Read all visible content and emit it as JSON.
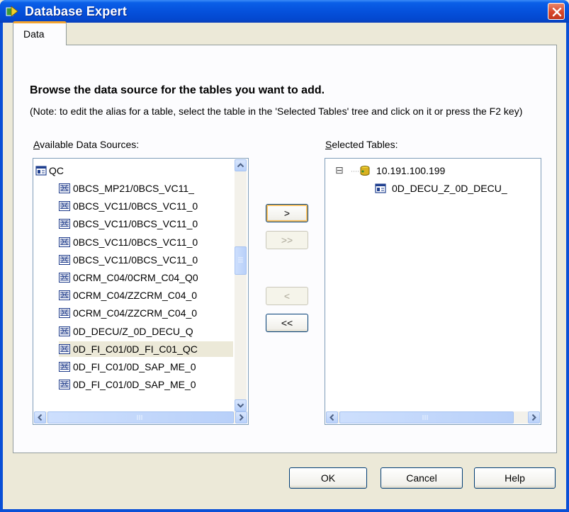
{
  "window": {
    "title": "Database Expert"
  },
  "tabs": [
    {
      "label": "Data"
    }
  ],
  "heading": "Browse the data source for the tables you want to add.",
  "note": "(Note: to edit the alias for a table, select the table in the 'Selected Tables' tree and click on it or press the F2 key)",
  "available": {
    "label_accel": "A",
    "label_rest": "vailable Data Sources:",
    "root": {
      "label": "QC",
      "icon": "database-icon"
    },
    "items": [
      {
        "label": "0BCS_MP21/0BCS_VC11_",
        "icon": "query-icon",
        "selected": false
      },
      {
        "label": "0BCS_VC11/0BCS_VC11_0",
        "icon": "query-icon",
        "selected": false
      },
      {
        "label": "0BCS_VC11/0BCS_VC11_0",
        "icon": "query-icon",
        "selected": false
      },
      {
        "label": "0BCS_VC11/0BCS_VC11_0",
        "icon": "query-icon",
        "selected": false
      },
      {
        "label": "0BCS_VC11/0BCS_VC11_0",
        "icon": "query-icon",
        "selected": false
      },
      {
        "label": "0CRM_C04/0CRM_C04_Q0",
        "icon": "query-icon",
        "selected": false
      },
      {
        "label": "0CRM_C04/ZZCRM_C04_0",
        "icon": "query-icon",
        "selected": false
      },
      {
        "label": "0CRM_C04/ZZCRM_C04_0",
        "icon": "query-icon",
        "selected": false
      },
      {
        "label": "0D_DECU/Z_0D_DECU_Q",
        "icon": "query-icon",
        "selected": false
      },
      {
        "label": "0D_FI_C01/0D_FI_C01_QC",
        "icon": "query-icon",
        "selected": true
      },
      {
        "label": "0D_FI_C01/0D_SAP_ME_0",
        "icon": "query-icon",
        "selected": false
      },
      {
        "label": "0D_FI_C01/0D_SAP_ME_0",
        "icon": "query-icon",
        "selected": false
      }
    ]
  },
  "selected_tables": {
    "label_accel": "S",
    "label_rest": "elected Tables:",
    "server": {
      "label": "10.191.100.199",
      "icon": "server-icon",
      "expander": "⊟"
    },
    "table": {
      "label": "0D_DECU_Z_0D_DECU_",
      "icon": "table-icon"
    }
  },
  "transfer_buttons": {
    "add": ">",
    "add_all": ">>",
    "remove": "<",
    "remove_all": "<<"
  },
  "footer": {
    "ok": "OK",
    "cancel": "Cancel",
    "help": "Help"
  },
  "colors": {
    "title_blue": "#0551dc",
    "tab_accent": "#f5a530",
    "selection": "#ece9d8"
  }
}
